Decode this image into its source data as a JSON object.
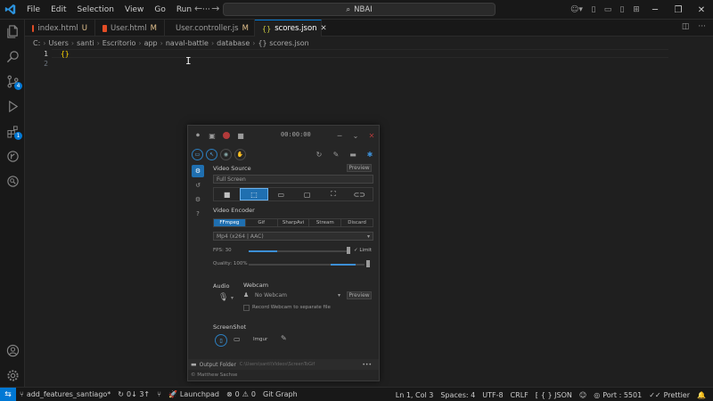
{
  "menu": [
    "File",
    "Edit",
    "Selection",
    "View",
    "Go",
    "Run",
    "···"
  ],
  "command_center": {
    "text": "NBAI"
  },
  "tabs": [
    {
      "name": "index.html",
      "status": "U",
      "icon_color": "#e44d26",
      "active": false
    },
    {
      "name": "User.html",
      "status": "M",
      "icon_color": "#e44d26",
      "active": false
    },
    {
      "name": "User.controller.js",
      "status": "M",
      "icon_color": "#cbcb41",
      "active": false
    },
    {
      "name": "scores.json",
      "status": "",
      "icon_color": "#cbcb41",
      "active": true
    }
  ],
  "breadcrumb": [
    "C:",
    "Users",
    "santi",
    "Escritorio",
    "app",
    "naval-battle",
    "database",
    "{} scores.json"
  ],
  "editor": {
    "lines": [
      {
        "number": "1",
        "text": "{}"
      },
      {
        "number": "2",
        "text": ""
      }
    ]
  },
  "activity_badges": {
    "source_control": "4",
    "extensions": "1"
  },
  "statusbar": {
    "branch": "add_features_santiago*",
    "sync": "0↓ 3↑",
    "launchpad": "Launchpad",
    "problems_errors": "0",
    "problems_warnings": "0",
    "git_graph": "Git Graph",
    "position": "Ln 1, Col 3",
    "spaces": "Spaces: 4",
    "encoding": "UTF-8",
    "eol": "CRLF",
    "language": "{ } JSON",
    "port": "Port : 5501",
    "prettier": "Prettier"
  },
  "recorder": {
    "timer": "00:00:00",
    "video_source_title": "Video Source",
    "preview_label": "Preview",
    "source_field": "Full Screen",
    "video_encoder_title": "Video Encoder",
    "encoders": [
      "FFmpeg",
      "Gif",
      "SharpAvi",
      "Stream",
      "Discard"
    ],
    "format": "Mp4 (x264 | AAC)",
    "fps_label": "FPS:",
    "fps_value": "30",
    "fps_fraction": 0.18,
    "limit_label": "Limit",
    "quality_label": "Quality:",
    "quality_value": "100%",
    "quality_fraction": 1.0,
    "audio_title": "Audio",
    "webcam_title": "Webcam",
    "webcam_device": "No Webcam",
    "webcam_preview": "Preview",
    "separate_file_label": "Record Webcam to separate file",
    "screenshot_title": "ScreenShot",
    "imgur_label": "Imgur",
    "output_folder_label": "Output Folder",
    "output_folder_path": "C:\\Users\\santi\\Videos\\ScreenToGif",
    "credit": "© Matthew Sachse"
  },
  "colors": {
    "accent": "#0078d4",
    "json_brace": "#ffd700",
    "modified": "#e2c08d",
    "recorder_accent": "#1f6fb0"
  }
}
